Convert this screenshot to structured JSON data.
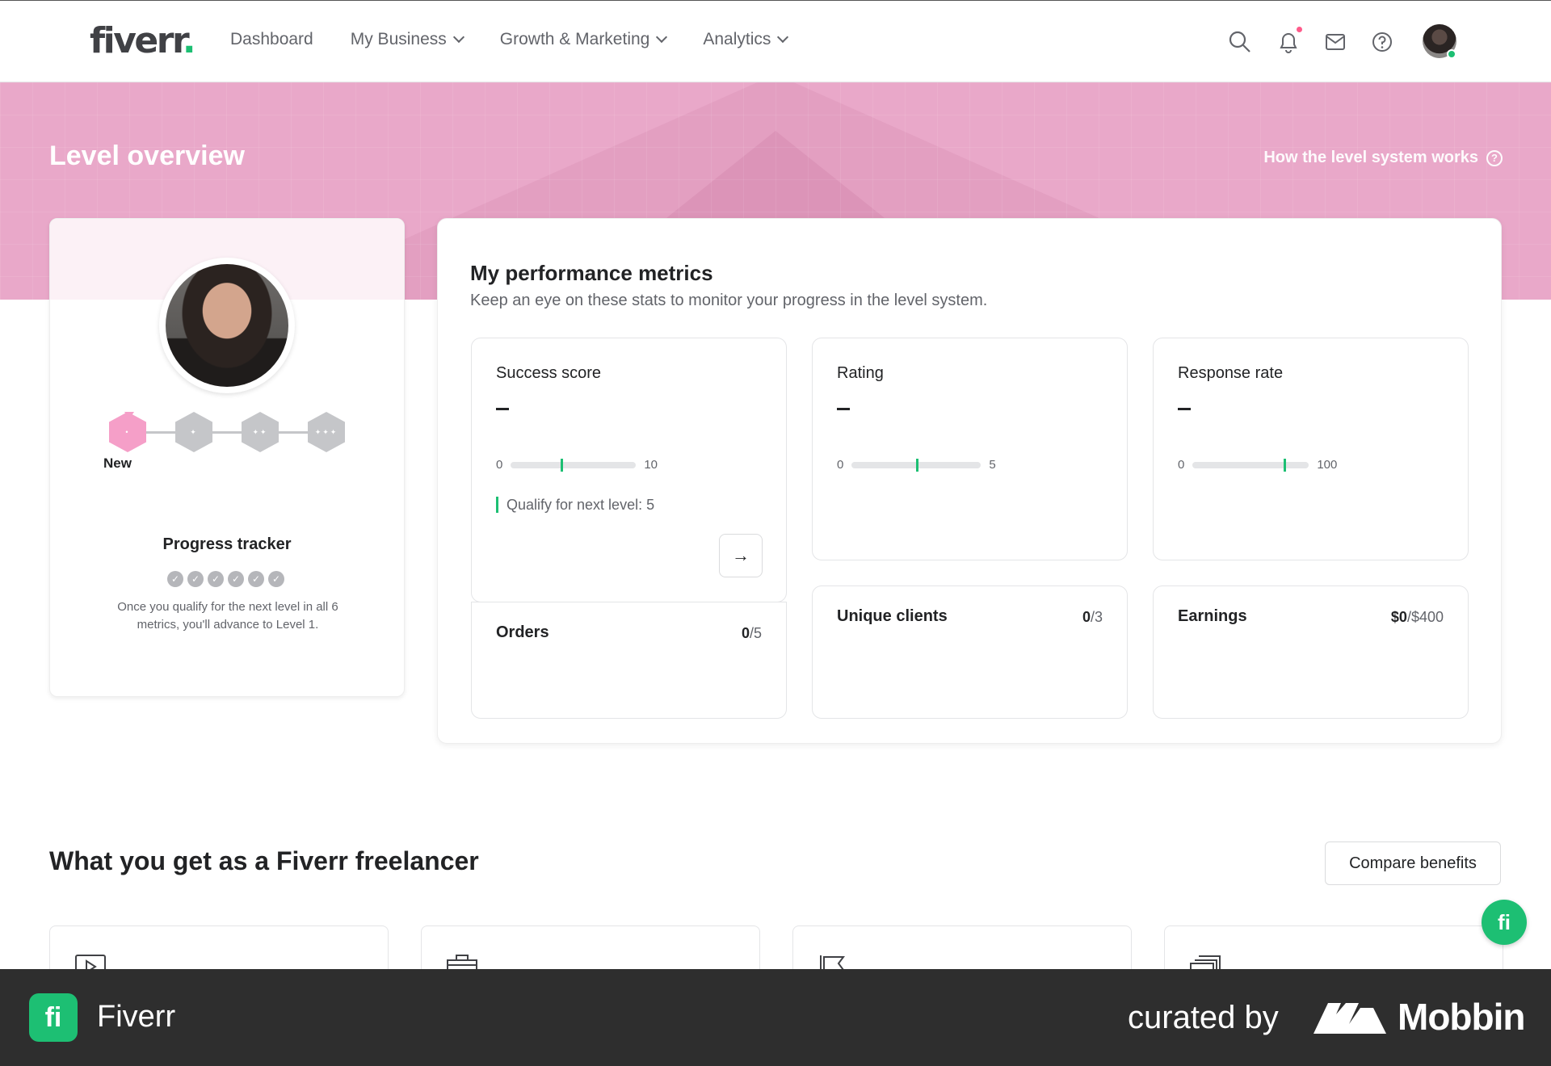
{
  "nav": {
    "logo": "fiverr",
    "logo_dot": ".",
    "items": [
      {
        "label": "Dashboard",
        "has_dropdown": false
      },
      {
        "label": "My Business",
        "has_dropdown": true
      },
      {
        "label": "Growth & Marketing",
        "has_dropdown": true
      },
      {
        "label": "Analytics",
        "has_dropdown": true
      }
    ],
    "icons": [
      "search-icon",
      "bell-icon",
      "mail-icon",
      "help-icon"
    ]
  },
  "hero": {
    "title": "Level overview",
    "link": "How the level system works",
    "link_icon": "?",
    "color": "#e9a8c9"
  },
  "profile_card": {
    "current_level_label": "New",
    "level_glyphs": [
      "•",
      "✦",
      "✦✦",
      "✦✦✦"
    ],
    "tracker_title": "Progress tracker",
    "tracker_checks": [
      "✓",
      "✓",
      "✓",
      "✓",
      "✓",
      "✓"
    ],
    "tracker_desc": "Once you qualify for the next level in all 6 metrics, you'll advance to Level 1."
  },
  "metrics_panel": {
    "title": "My performance metrics",
    "subtitle": "Keep an eye on these stats to monitor your progress in the level system.",
    "success_score": {
      "label": "Success score",
      "min": "0",
      "max": "10",
      "marker_fraction": 0.4,
      "qualify": "Qualify for next level: 5",
      "arrow": "→"
    },
    "rating": {
      "label": "Rating",
      "min": "0",
      "max": "5",
      "marker_fraction": 0.5
    },
    "response_rate": {
      "label": "Response rate",
      "min": "0",
      "max": "100",
      "marker_fraction": 0.78
    },
    "orders": {
      "label": "Orders",
      "current": "0",
      "target": "/5"
    },
    "unique_clients": {
      "label": "Unique clients",
      "current": "0",
      "target": "/3"
    },
    "earnings": {
      "label": "Earnings",
      "current": "$0",
      "target": "/$400"
    }
  },
  "benefits": {
    "title": "What you get as a Fiverr freelancer",
    "compare_button": "Compare benefits",
    "fab": "fi"
  },
  "footer": {
    "app_icon": "fi",
    "app_name": "Fiverr",
    "curated_by": "curated by",
    "brand": "Mobbin"
  },
  "colors": {
    "accent_green": "#1dbf73",
    "pink": "#f59fc8"
  }
}
